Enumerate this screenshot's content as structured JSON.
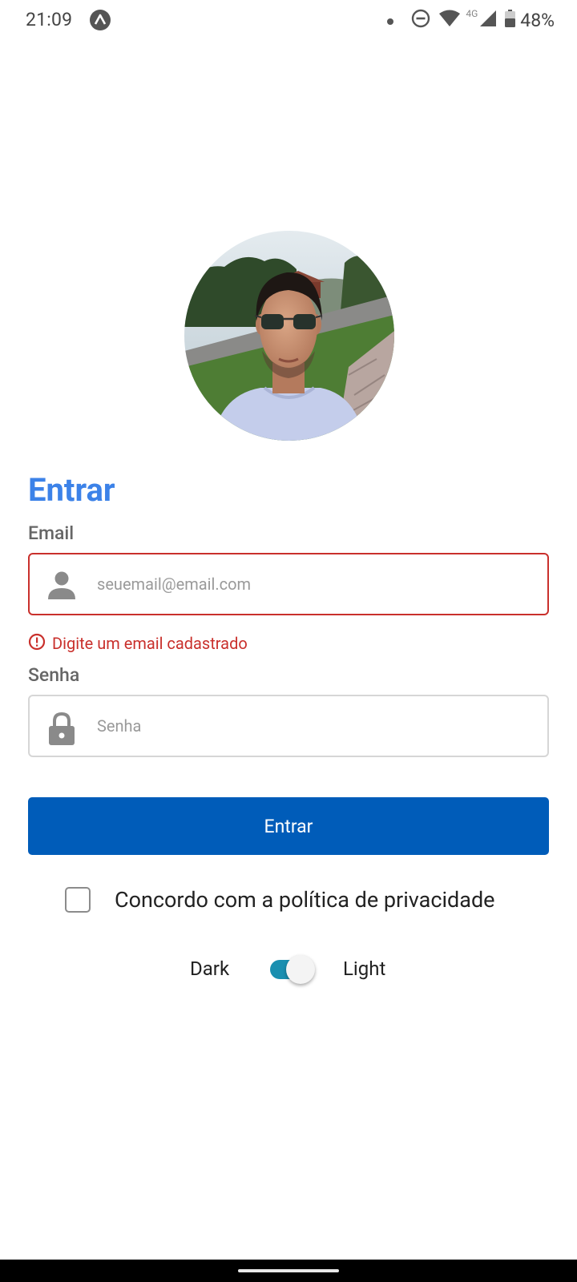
{
  "status_bar": {
    "time": "21:09",
    "network_label": "4G",
    "battery_percent": "48%",
    "icons": [
      "expo-app-icon",
      "notification-dot-icon",
      "do-not-disturb-icon",
      "wifi-icon",
      "cell-signal-icon",
      "battery-icon"
    ]
  },
  "avatar": {
    "icon": "profile-photo"
  },
  "login": {
    "title": "Entrar",
    "email": {
      "label": "Email",
      "placeholder": "seuemail@email.com",
      "value": "",
      "icon": "person-icon",
      "error": "Digite um email cadastrado",
      "error_icon": "error-icon"
    },
    "password": {
      "label": "Senha",
      "placeholder": "Senha",
      "value": "",
      "icon": "lock-icon"
    },
    "submit_label": "Entrar",
    "privacy_label": "Concordo com a política de privacidade",
    "privacy_checked": false
  },
  "theme": {
    "dark_label": "Dark",
    "light_label": "Light",
    "toggle_on": true
  },
  "colors": {
    "accent": "#3c82e8",
    "button": "#005cb9",
    "error": "#c9302c",
    "toggle": "#1a8fb0"
  }
}
